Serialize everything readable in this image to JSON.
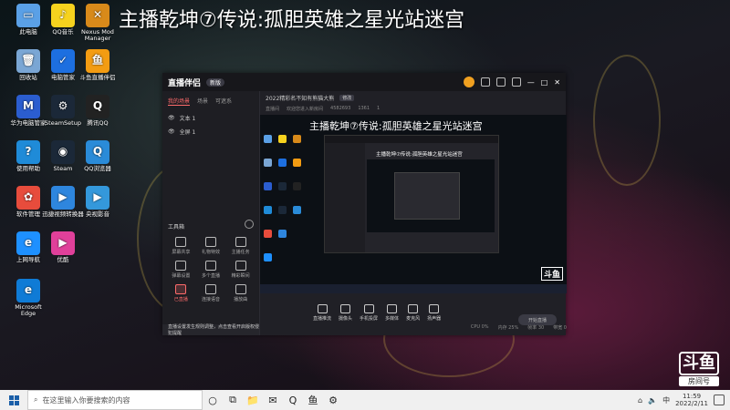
{
  "overlay_title": "主播乾坤⑦传说:孤胆英雄之星光站迷宫",
  "desktop_icons": [
    {
      "label": "此电脑",
      "icon": "computer-icon",
      "color": "#5aa0e6",
      "glyph": "▭"
    },
    {
      "label": "QQ音乐",
      "icon": "music-icon",
      "color": "#f6d21e",
      "glyph": "♪"
    },
    {
      "label": "Nexus Mod Manager",
      "icon": "nexus-icon",
      "color": "#d88a1a",
      "glyph": "✕"
    },
    {
      "label": "回收站",
      "icon": "recycle-bin-icon",
      "color": "#7aa6d4",
      "glyph": "🗑"
    },
    {
      "label": "电脑管家",
      "icon": "shield-icon",
      "color": "#1d6fe0",
      "glyph": "✓"
    },
    {
      "label": "斗鱼直播伴侣",
      "icon": "douyu-icon",
      "color": "#f39c12",
      "glyph": "鱼"
    },
    {
      "label": "华为电脑管家",
      "icon": "huawei-icon",
      "color": "#2b5dcf",
      "glyph": "M"
    },
    {
      "label": "SteamSetup",
      "icon": "steam-setup-icon",
      "color": "#1b2838",
      "glyph": "⚙"
    },
    {
      "label": "腾讯QQ",
      "icon": "qq-icon",
      "color": "#222222",
      "glyph": "Q"
    },
    {
      "label": "使用帮助",
      "icon": "help-icon",
      "color": "#1f8bd8",
      "glyph": "?"
    },
    {
      "label": "Steam",
      "icon": "steam-icon",
      "color": "#1b2838",
      "glyph": "◉"
    },
    {
      "label": "QQ浏览器",
      "icon": "browser-icon",
      "color": "#2a8bd8",
      "glyph": "Q"
    },
    {
      "label": "软件管理",
      "icon": "software-icon",
      "color": "#e74c3c",
      "glyph": "✿"
    },
    {
      "label": "迅捷视频转换器",
      "icon": "video-converter-icon",
      "color": "#2e86de",
      "glyph": "▶"
    },
    {
      "label": "央视影音",
      "icon": "cctv-icon",
      "color": "#3498db",
      "glyph": "▶"
    },
    {
      "label": "上网导航",
      "icon": "ie-icon",
      "color": "#1e90ff",
      "glyph": "e"
    },
    {
      "label": "优酷",
      "icon": "youku-icon",
      "color": "#e0409a",
      "glyph": "▶"
    },
    {
      "label": "Microsoft Edge",
      "icon": "edge-icon",
      "color": "#0f7bd6",
      "glyph": "e"
    }
  ],
  "app": {
    "logo": "直播伴侣",
    "version": "新版",
    "left_tabs": [
      "我的场景",
      "场景",
      "可遮系"
    ],
    "layers": [
      "文本 1",
      "全屏 1"
    ],
    "tools_title": "工具箱",
    "tools": [
      "屏幕共享",
      "礼物特效",
      "主播任务",
      "弹幕设置",
      "多个直播",
      "精彩瞬间",
      "已直播",
      "连接语音",
      "播放曲"
    ],
    "notice": "直播设置发生规则调整，点击查看开启版权侵犯提醒",
    "stream_title": "2022精彩名不知有熊猫大熊",
    "stream_tag": "修改",
    "stream_meta": [
      "直播间",
      "欢迎您进入新房间",
      "4582693",
      "1361",
      "1"
    ],
    "preview_title": "主播乾坤⑦传说:孤胆英雄之星光站迷宫",
    "nested_title": "主播乾坤⑦传说:孤胆英雄之星光站迷宫",
    "preview_watermark": "斗鱼",
    "controls": [
      "直播推流",
      "摄像头",
      "手机投屏",
      "多媒体",
      "麦克风",
      "扬声器"
    ],
    "start_label": "开始直播",
    "status": [
      "CPU 0%",
      "内存 25%",
      "帧率 30",
      "带宽 0"
    ]
  },
  "watermark": {
    "big": "斗鱼",
    "small": "房间号"
  },
  "taskbar": {
    "search_placeholder": "在这里输入你要搜索的内容",
    "time": "11:59",
    "date": "2022/2/11",
    "apps": [
      {
        "icon": "cortana-icon",
        "glyph": "○"
      },
      {
        "icon": "task-view-icon",
        "glyph": "⧉"
      },
      {
        "icon": "file-explorer-icon",
        "glyph": "📁"
      },
      {
        "icon": "mail-icon",
        "glyph": "✉"
      },
      {
        "icon": "qq-browser-icon",
        "glyph": "Q"
      },
      {
        "icon": "douyu-taskbar-icon",
        "glyph": "鱼"
      },
      {
        "icon": "settings-icon",
        "glyph": "⚙"
      }
    ]
  }
}
